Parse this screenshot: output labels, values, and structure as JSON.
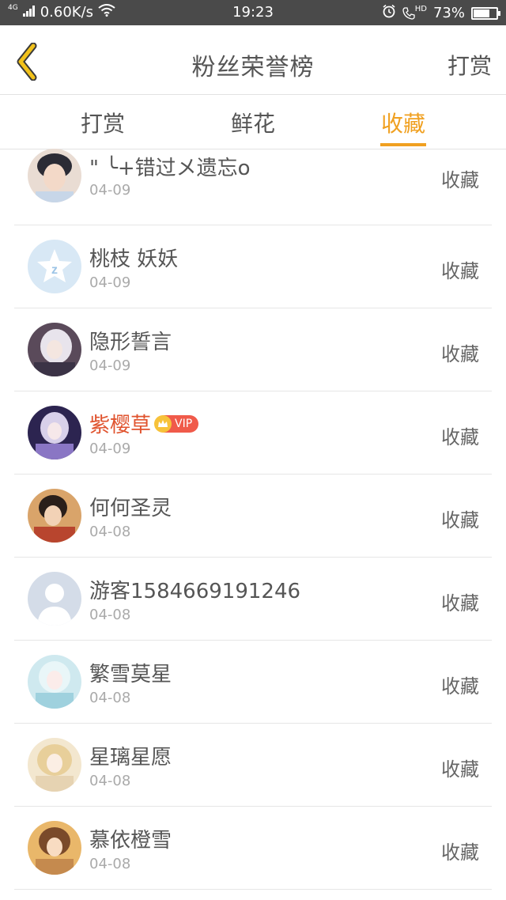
{
  "status_bar": {
    "network": "4G",
    "speed": "0.60K/s",
    "time": "19:23",
    "hd": "HD",
    "battery": "73%",
    "battery_level": 0.73
  },
  "header": {
    "title": "粉丝荣誉榜",
    "right_label": "打赏"
  },
  "tabs": [
    {
      "label": "打赏",
      "active": false
    },
    {
      "label": "鲜花",
      "active": false
    },
    {
      "label": "收藏",
      "active": true
    }
  ],
  "accent_color": "#f0a020",
  "vip_badge_label": "VIP",
  "list": [
    {
      "name": "\"  ╰+错过メ遗忘o",
      "date": "04-09",
      "action": "收藏",
      "vip": false
    },
    {
      "name": "桃枝 妖妖",
      "date": "04-09",
      "action": "收藏",
      "vip": false
    },
    {
      "name": "隐形誓言",
      "date": "04-09",
      "action": "收藏",
      "vip": false
    },
    {
      "name": "紫樱草",
      "date": "04-09",
      "action": "收藏",
      "vip": true
    },
    {
      "name": "何何圣灵",
      "date": "04-08",
      "action": "收藏",
      "vip": false
    },
    {
      "name": "游客1584669191246",
      "date": "04-08",
      "action": "收藏",
      "vip": false
    },
    {
      "name": "繁雪莫星",
      "date": "04-08",
      "action": "收藏",
      "vip": false
    },
    {
      "name": "星璃星愿",
      "date": "04-08",
      "action": "收藏",
      "vip": false
    },
    {
      "name": "慕依橙雪",
      "date": "04-08",
      "action": "收藏",
      "vip": false
    }
  ]
}
